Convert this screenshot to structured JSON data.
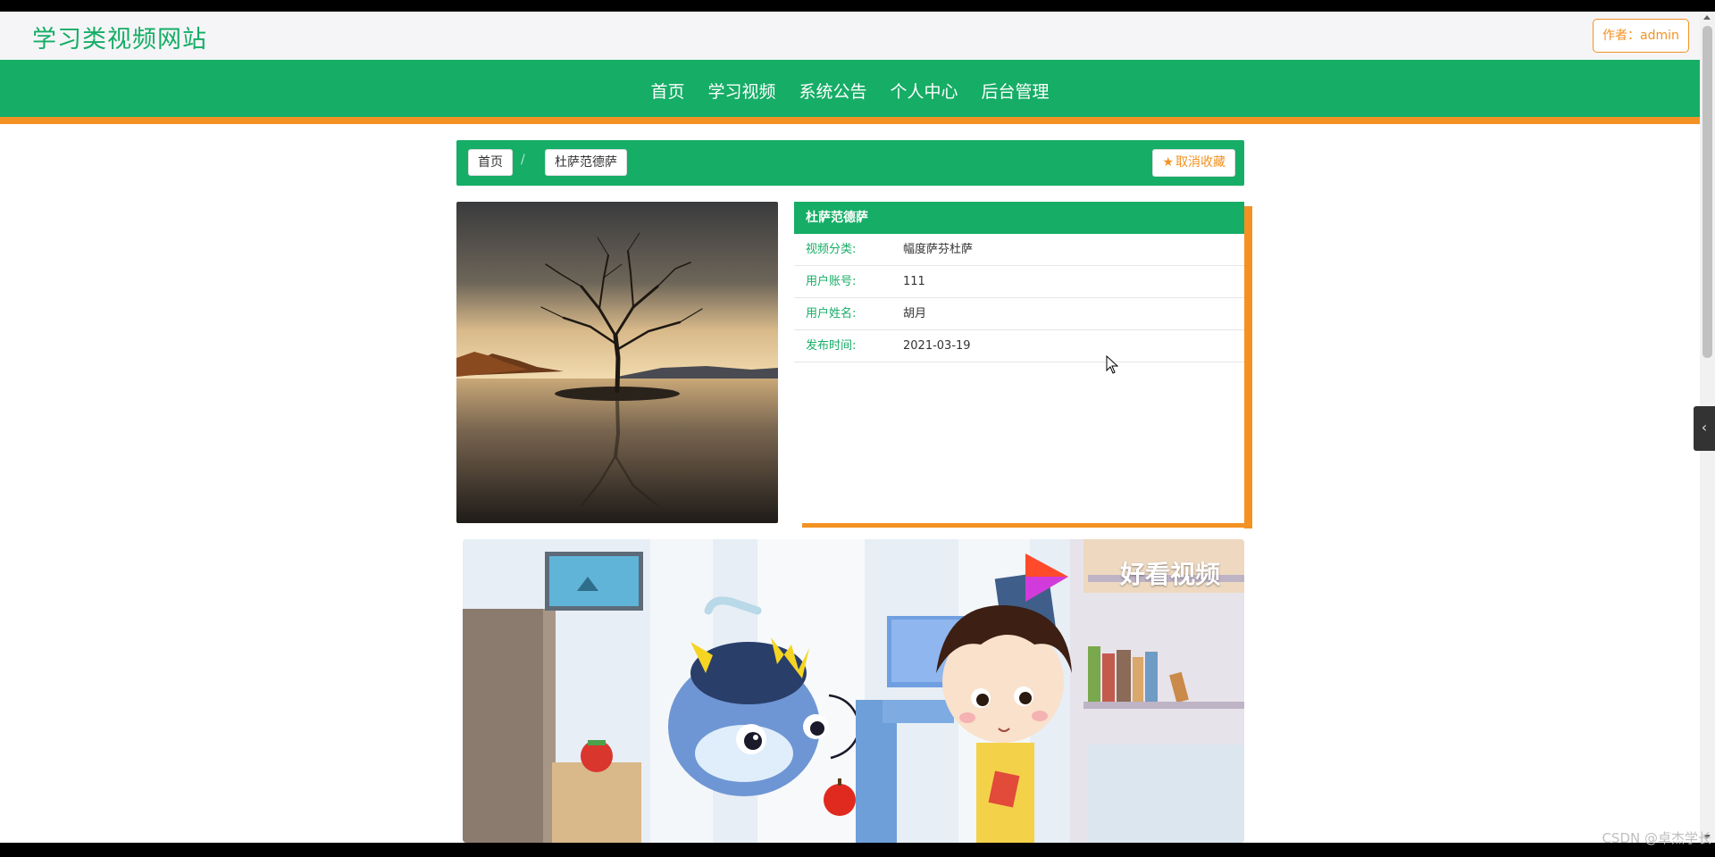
{
  "site": {
    "title": "学习类视频网站",
    "author_badge": "作者：admin"
  },
  "nav": {
    "items": [
      "首页",
      "学习视频",
      "系统公告",
      "个人中心",
      "后台管理"
    ]
  },
  "breadcrumb": {
    "home": "首页",
    "separator": "/",
    "current": "杜萨范德萨",
    "unfavorite_label": "取消收藏"
  },
  "detail": {
    "title": "杜萨范德萨",
    "rows": [
      {
        "label": "视频分类:",
        "value": "幅度萨芬杜萨"
      },
      {
        "label": "用户账号:",
        "value": "111"
      },
      {
        "label": "用户姓名:",
        "value": "胡月"
      },
      {
        "label": "发布时间:",
        "value": "2021-03-19"
      }
    ]
  },
  "video": {
    "watermark": "好看视频"
  },
  "footer": {
    "credit": "CSDN @卓杰学长"
  },
  "icons": {
    "favorite": "star-icon",
    "side_toggle": "chevron-left-icon",
    "cursor": "mouse-pointer-icon"
  },
  "colors": {
    "brand_green": "#16ad66",
    "accent_orange": "#f39223"
  }
}
